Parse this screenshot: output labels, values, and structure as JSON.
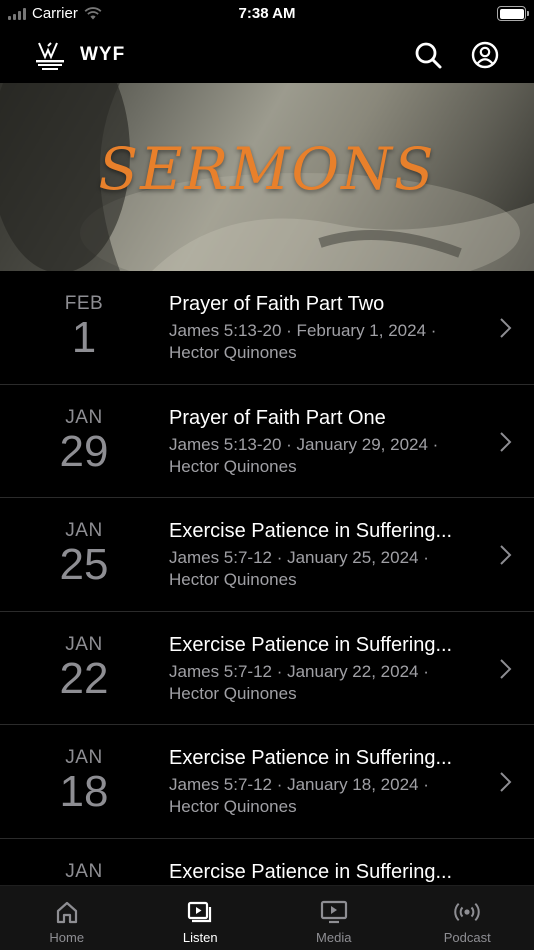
{
  "status": {
    "carrier": "Carrier",
    "time": "7:38 AM"
  },
  "header": {
    "logo_text": "WHO YOU FOLLOW",
    "brand": "WYF"
  },
  "banner": {
    "title": "SERMONS"
  },
  "sermons": [
    {
      "month": "FEB",
      "day": "1",
      "title": "Prayer of Faith Part Two",
      "line1": "James 5:13-20 · February 1, 2024 ·",
      "line2": "Hector Quinones"
    },
    {
      "month": "JAN",
      "day": "29",
      "title": "Prayer of Faith Part One",
      "line1": "James 5:13-20 · January 29, 2024 ·",
      "line2": "Hector Quinones"
    },
    {
      "month": "JAN",
      "day": "25",
      "title": "Exercise Patience in Suffering...",
      "line1": "James 5:7-12 · January 25, 2024 ·",
      "line2": "Hector Quinones"
    },
    {
      "month": "JAN",
      "day": "22",
      "title": "Exercise Patience in Suffering...",
      "line1": "James 5:7-12 · January 22, 2024 ·",
      "line2": "Hector Quinones"
    },
    {
      "month": "JAN",
      "day": "18",
      "title": "Exercise Patience in Suffering...",
      "line1": "James 5:7-12 · January 18, 2024 ·",
      "line2": "Hector Quinones"
    },
    {
      "month": "JAN",
      "day": "",
      "title": "Exercise Patience in Suffering...",
      "line1": "",
      "line2": ""
    }
  ],
  "tabs": [
    {
      "label": "Home",
      "icon": "home-icon"
    },
    {
      "label": "Listen",
      "icon": "listen-icon"
    },
    {
      "label": "Media",
      "icon": "media-icon"
    },
    {
      "label": "Podcast",
      "icon": "podcast-icon"
    }
  ],
  "active_tab": "Listen",
  "colors": {
    "accent": "#e8802b",
    "background": "#000000",
    "muted": "#8e8e93"
  }
}
